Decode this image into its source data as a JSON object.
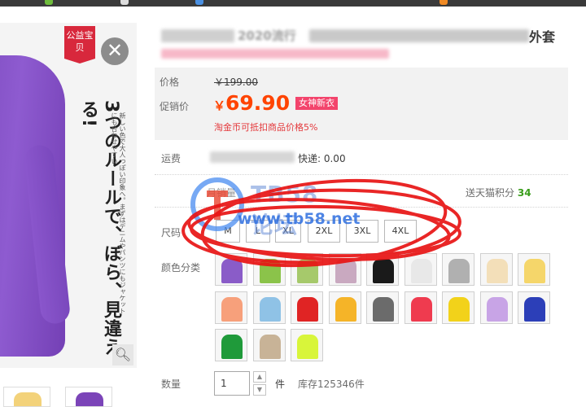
{
  "gallery": {
    "badge": "公益宝贝",
    "image_text": "3つのルールで、ぼら、見違える!",
    "image_fineprint": "新しい色で大人っぽい印象へ。まずはデニムやパンツにもジャケットにも合わせやすい",
    "close_icon": "close-icon",
    "zoom_icon": "magnifier-icon"
  },
  "product": {
    "title_visible": "2020流行",
    "title_tail": "外套",
    "price_label": "价格",
    "original_price": "￥199.00",
    "promo_label": "促销价",
    "promo_currency": "￥",
    "promo_price": "69.90",
    "promo_tag": "女神新衣",
    "coin_note": "淘金币可抵扣商品价格5%",
    "shipping_label": "运费",
    "shipping_value": "快递: 0.00",
    "points_label": "送天猫积分",
    "points_value": "34",
    "sales_label": "月销量"
  },
  "sizes": {
    "label": "尺码",
    "options": [
      "M",
      "L",
      "XL",
      "2XL",
      "3XL",
      "4XL"
    ]
  },
  "colors": {
    "label": "颜色分类",
    "swatches": [
      "#8a5cc8",
      "#8bc34a",
      "#a6c96b",
      "#c9a9c0",
      "#1a1a1a",
      "#e8e8e8",
      "#b0b0b0",
      "#f3dfb9",
      "#f5d66a",
      "#f7a07b",
      "#8fc2e6",
      "#e02424",
      "#f5b428",
      "#6b6b6b",
      "#ef3b4f",
      "#f2d21a",
      "#c8a4e6",
      "#2c3fb8",
      "#1f9a3a",
      "#c8b397",
      "#d8f53a"
    ]
  },
  "quantity": {
    "label": "数量",
    "value": "1",
    "unit": "件",
    "stock": "库存125346件"
  },
  "watermark": {
    "title": "TB58论坛",
    "url": "www.tb58.net",
    "color": "#2f6fe0"
  },
  "colors_theme": {
    "price_red": "#ff4400",
    "tag_pink": "#f3446c",
    "badge_red": "#d8283c",
    "annotation_red": "#e81414"
  }
}
